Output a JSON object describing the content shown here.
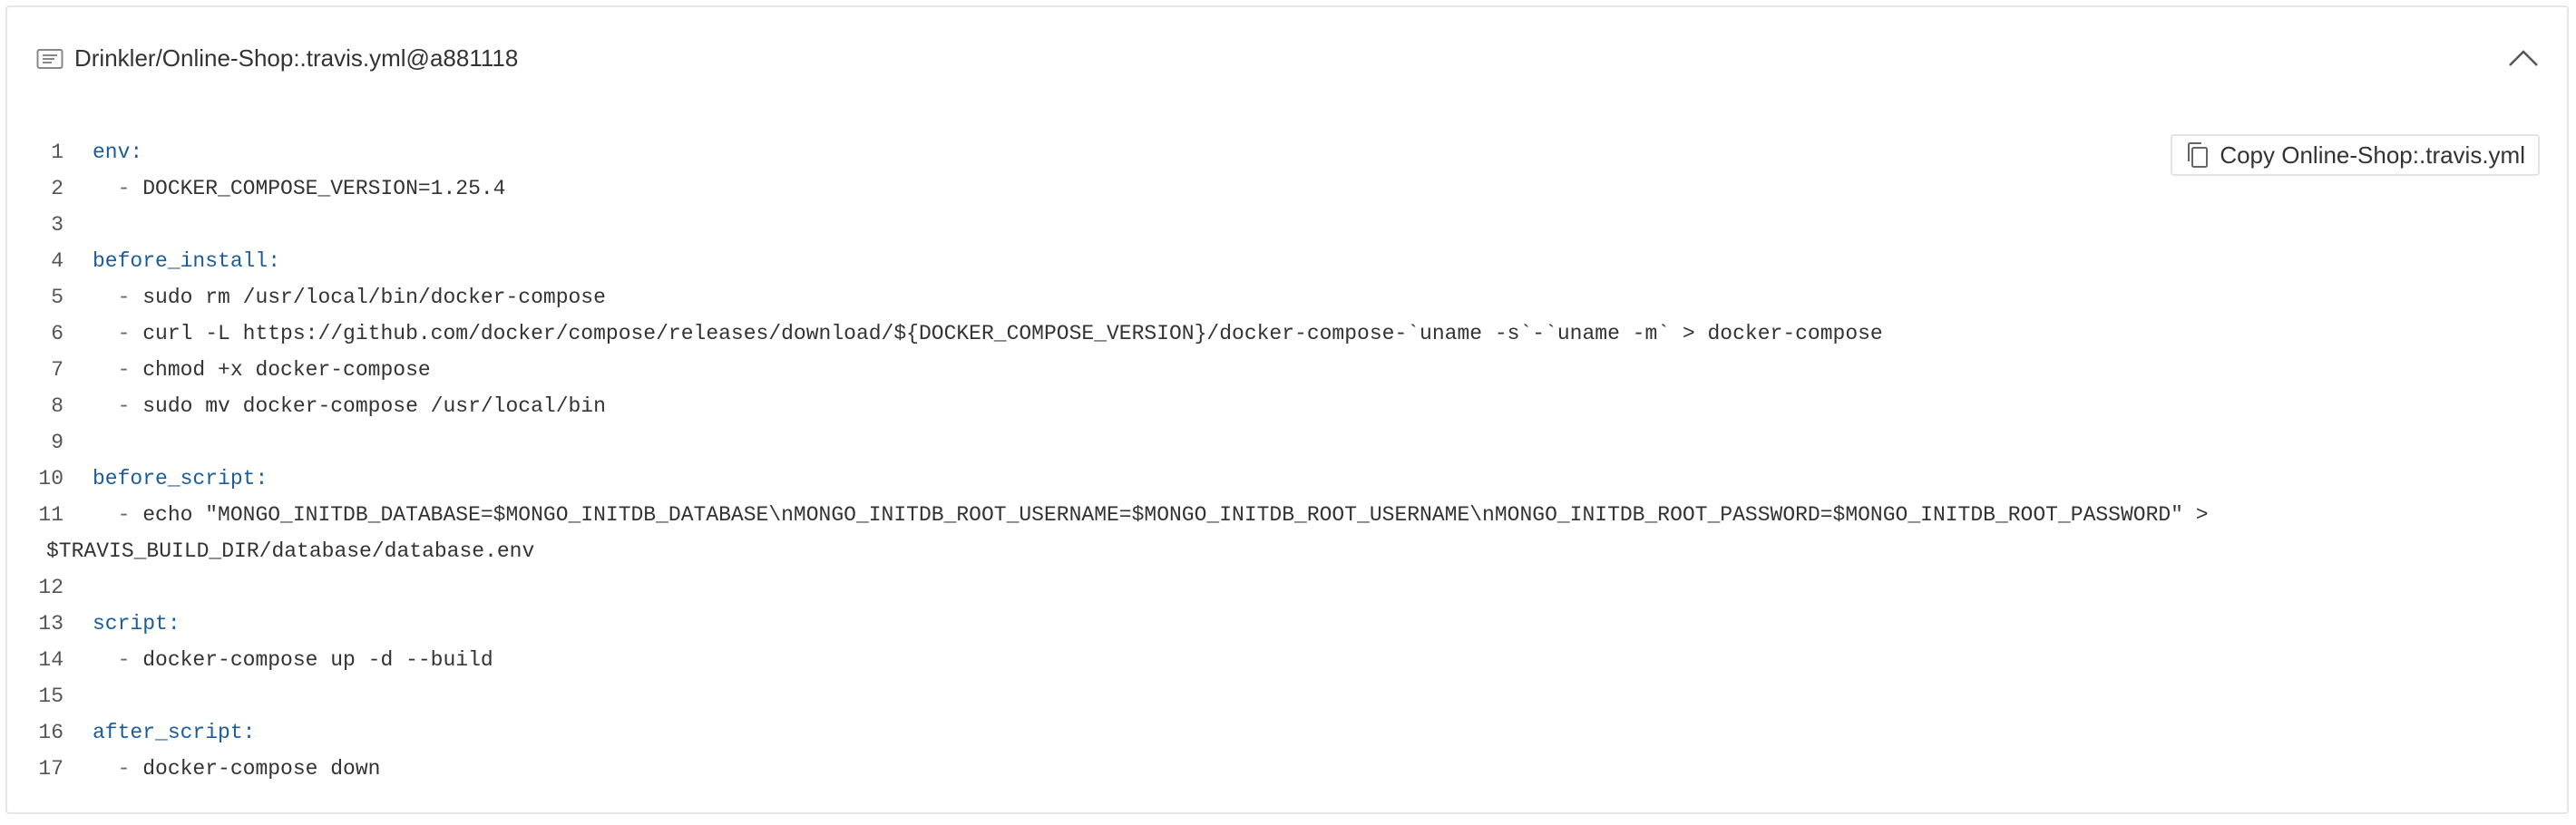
{
  "header": {
    "file_title": "Drinkler/Online-Shop:.travis.yml@a881118"
  },
  "copy_button": {
    "label": "Copy Online-Shop:.travis.yml"
  },
  "code": {
    "lines": [
      {
        "num": "1",
        "key": "env",
        "colon": ":"
      },
      {
        "num": "2",
        "dash": "  - ",
        "text": "DOCKER_COMPOSE_VERSION=1.25.4"
      },
      {
        "num": "3"
      },
      {
        "num": "4",
        "key": "before_install",
        "colon": ":"
      },
      {
        "num": "5",
        "dash": "  - ",
        "text": "sudo rm /usr/local/bin/docker-compose"
      },
      {
        "num": "6",
        "dash": "  - ",
        "text": "curl -L https://github.com/docker/compose/releases/download/${DOCKER_COMPOSE_VERSION}/docker-compose-`uname -s`-`uname -m` > docker-compose"
      },
      {
        "num": "7",
        "dash": "  - ",
        "text": "chmod +x docker-compose"
      },
      {
        "num": "8",
        "dash": "  - ",
        "text": "sudo mv docker-compose /usr/local/bin"
      },
      {
        "num": "9"
      },
      {
        "num": "10",
        "key": "before_script",
        "colon": ":"
      },
      {
        "num": "11",
        "dash": "  - ",
        "text": "echo \"MONGO_INITDB_DATABASE=$MONGO_INITDB_DATABASE\\nMONGO_INITDB_ROOT_USERNAME=$MONGO_INITDB_ROOT_USERNAME\\nMONGO_INITDB_ROOT_PASSWORD=$MONGO_INITDB_ROOT_PASSWORD\" >",
        "cont": "$TRAVIS_BUILD_DIR/database/database.env"
      },
      {
        "num": "12"
      },
      {
        "num": "13",
        "key": "script",
        "colon": ":"
      },
      {
        "num": "14",
        "dash": "  - ",
        "text": "docker-compose up -d --build"
      },
      {
        "num": "15"
      },
      {
        "num": "16",
        "key": "after_script",
        "colon": ":"
      },
      {
        "num": "17",
        "dash": "  - ",
        "text": "docker-compose down"
      }
    ]
  },
  "icons": {
    "file": "file-code-icon",
    "collapse": "chevron-up-icon",
    "copy": "copy-icon"
  },
  "colors": {
    "key": "#1b5c9a",
    "text": "#333333",
    "line_number": "#555555",
    "border": "#e6e6e6"
  }
}
